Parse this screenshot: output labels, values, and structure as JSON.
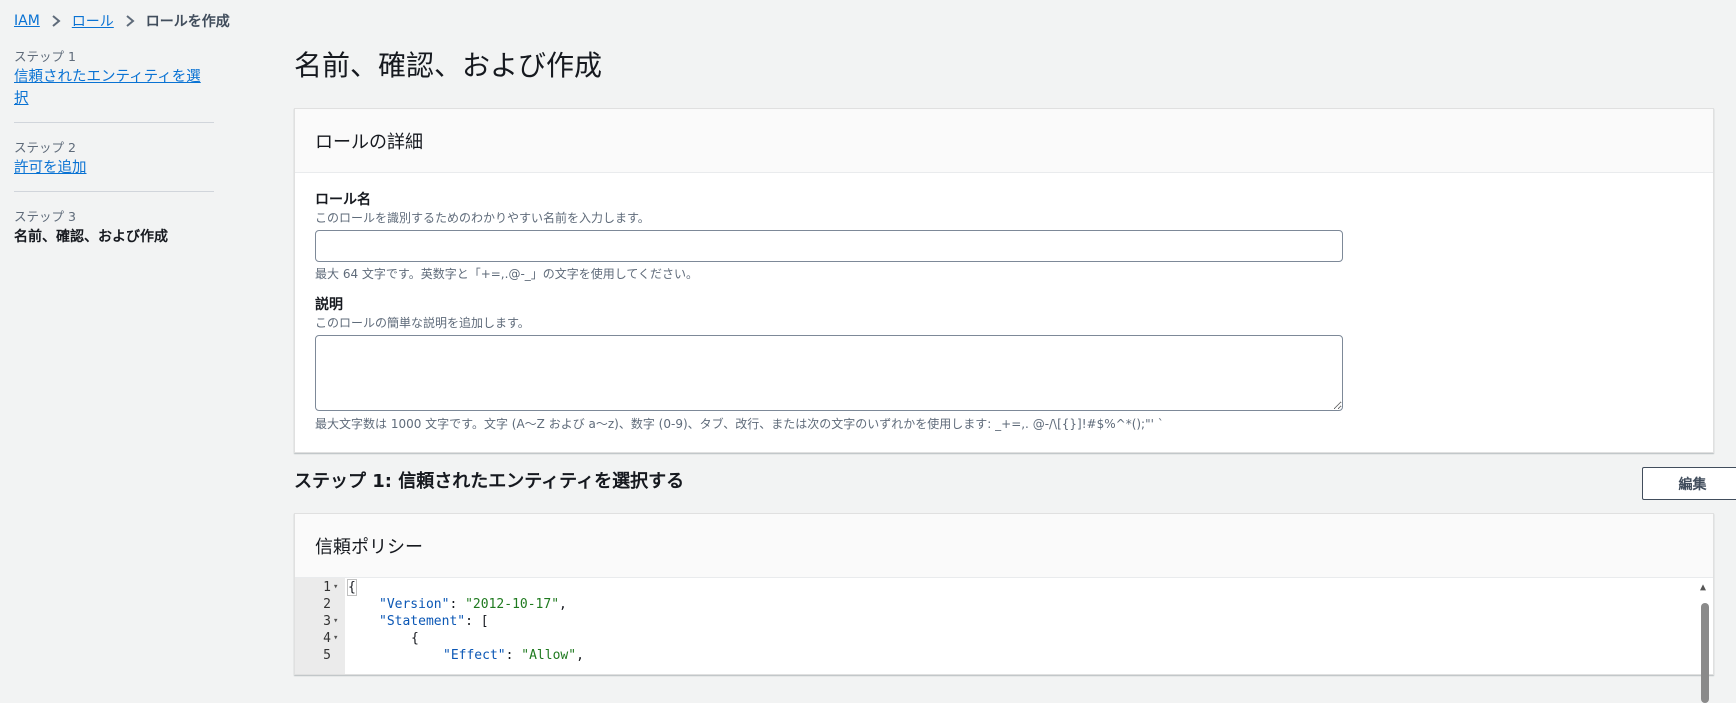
{
  "breadcrumb": {
    "items": [
      "IAM",
      "ロール"
    ],
    "current": "ロールを作成"
  },
  "nav": {
    "steps": [
      {
        "label": "ステップ 1",
        "title": "信頼されたエンティティを選択"
      },
      {
        "label": "ステップ 2",
        "title": "許可を追加"
      },
      {
        "label": "ステップ 3",
        "title": "名前、確認、および作成"
      }
    ]
  },
  "page_title": "名前、確認、および作成",
  "role_details": {
    "header": "ロールの詳細",
    "name": {
      "label": "ロール名",
      "description": "このロールを識別するためのわかりやすい名前を入力します。",
      "value": "",
      "hint": "最大 64 文字です。英数字と「+=,.@-_」の文字を使用してください。"
    },
    "description": {
      "label": "説明",
      "description": "このロールの簡単な説明を追加します。",
      "value": "",
      "hint": "最大文字数は 1000 文字です。文字 (A〜Z および a〜z)、数字 (0-9)、タブ、改行、または次の文字のいずれかを使用します: _+=,. @-/\\[{}]!#$%^*();\"' `"
    }
  },
  "step1_section": {
    "title": "ステップ 1: 信頼されたエンティティを選択する",
    "edit_label": "編集"
  },
  "trust_policy": {
    "header": "信頼ポリシー",
    "code_lines": [
      {
        "num": "1",
        "fold": true,
        "indent": 0,
        "tokens": [
          {
            "t": "{",
            "c": "p"
          }
        ]
      },
      {
        "num": "2",
        "fold": false,
        "indent": 1,
        "tokens": [
          {
            "t": "\"Version\"",
            "c": "k"
          },
          {
            "t": ": ",
            "c": "p"
          },
          {
            "t": "\"2012-10-17\"",
            "c": "s"
          },
          {
            "t": ",",
            "c": "p"
          }
        ]
      },
      {
        "num": "3",
        "fold": true,
        "indent": 1,
        "tokens": [
          {
            "t": "\"Statement\"",
            "c": "k"
          },
          {
            "t": ": [",
            "c": "p"
          }
        ]
      },
      {
        "num": "4",
        "fold": true,
        "indent": 2,
        "tokens": [
          {
            "t": "{",
            "c": "p"
          }
        ]
      },
      {
        "num": "5",
        "fold": false,
        "indent": 3,
        "tokens": [
          {
            "t": "\"Effect\"",
            "c": "k"
          },
          {
            "t": ": ",
            "c": "p"
          },
          {
            "t": "\"Allow\"",
            "c": "s"
          },
          {
            "t": ",",
            "c": "p"
          }
        ]
      }
    ]
  }
}
